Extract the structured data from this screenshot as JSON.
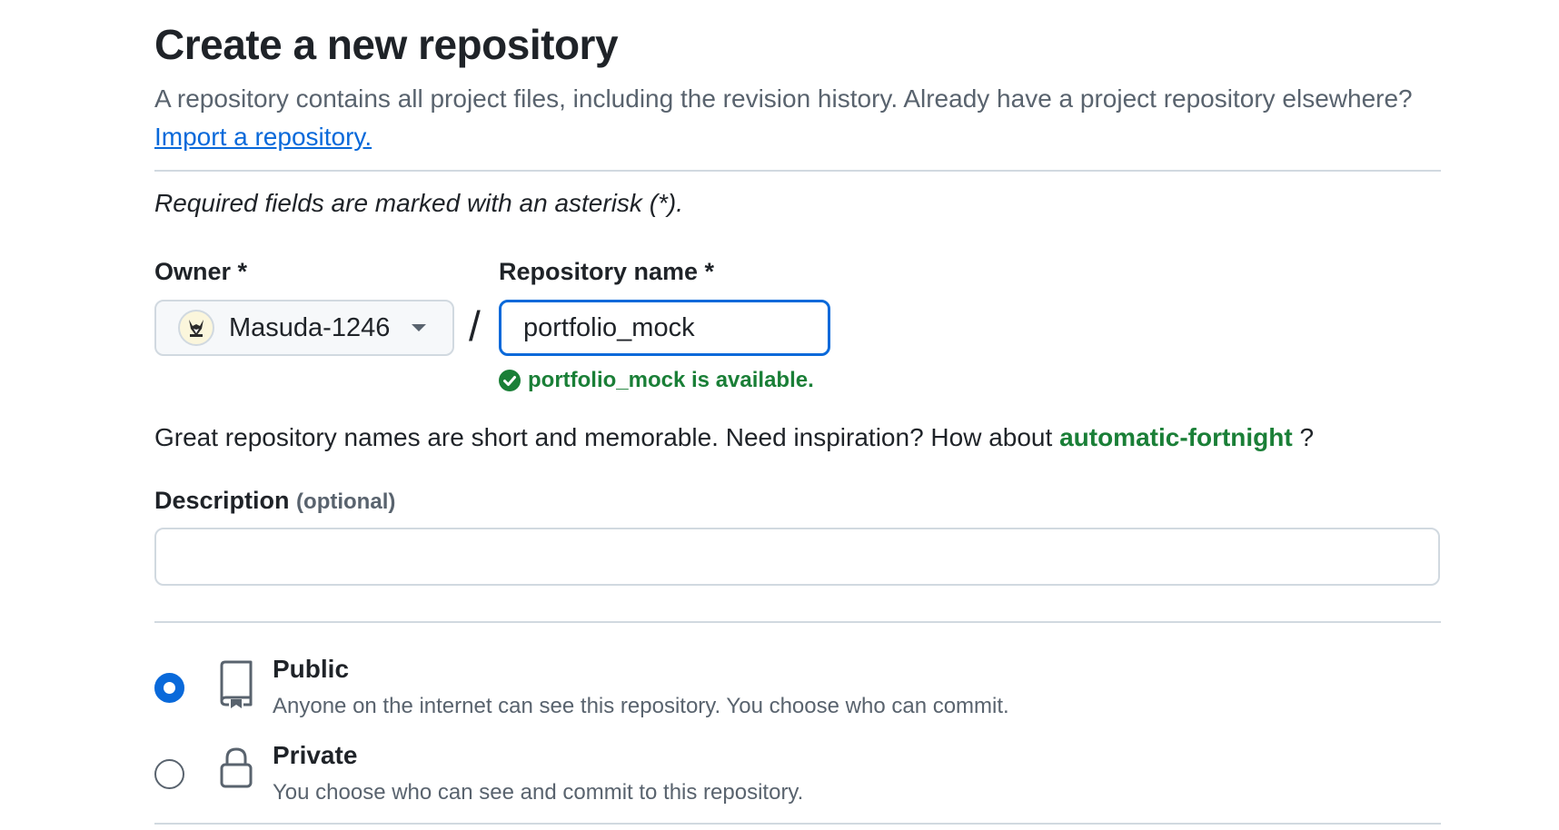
{
  "header": {
    "title": "Create a new repository",
    "intro_text": "A repository contains all project files, including the revision history. Already have a project repository elsewhere?",
    "import_link": "Import a repository."
  },
  "form": {
    "required_note": "Required fields are marked with an asterisk (*).",
    "owner": {
      "label": "Owner *",
      "value": "Masuda-1246",
      "avatar_icon": "fox-avatar-icon"
    },
    "separator": "/",
    "repo_name": {
      "label": "Repository name *",
      "value": "portfolio_mock",
      "availability": "portfolio_mock is available."
    },
    "inspiration": {
      "text": "Great repository names are short and memorable. Need inspiration? How about",
      "suggestion": "automatic-fortnight",
      "suffix": "?"
    },
    "description": {
      "label": "Description",
      "optional": "(optional)",
      "value": ""
    },
    "visibility": {
      "selected": "public",
      "options": [
        {
          "title": "Public",
          "desc": "Anyone on the internet can see this repository. You choose who can commit.",
          "icon": "repo-icon"
        },
        {
          "title": "Private",
          "desc": "You choose who can see and commit to this repository.",
          "icon": "lock-icon"
        }
      ]
    }
  },
  "colors": {
    "accent": "#0969da",
    "success": "#1a7f37",
    "muted_text": "#59636e",
    "border": "#d1d9e0"
  }
}
